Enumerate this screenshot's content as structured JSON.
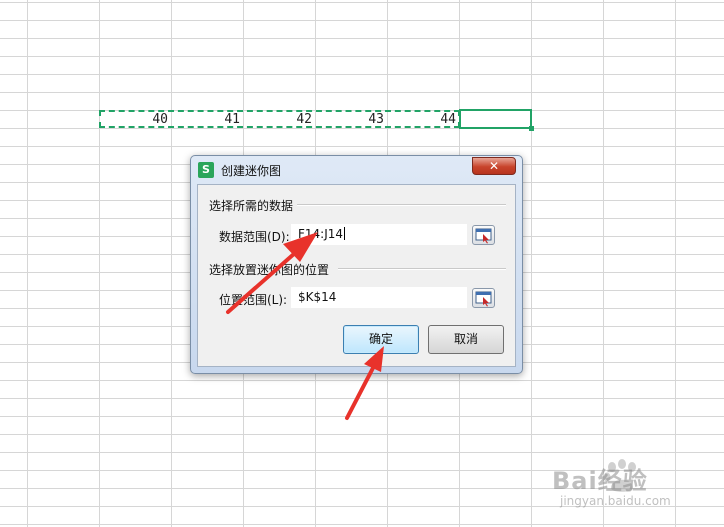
{
  "sheet": {
    "row_values": [
      "40",
      "41",
      "42",
      "43",
      "44"
    ]
  },
  "dialog": {
    "app_icon_letter": "S",
    "title": "创建迷你图",
    "close_glyph": "✕",
    "section_data": "选择所需的数据",
    "data_range_label": "数据范围(D):",
    "data_range_value": "F14:J14",
    "section_location": "选择放置迷你图的位置",
    "location_range_label": "位置范围(L):",
    "location_range_value": "$K$14",
    "ok_label": "确定",
    "cancel_label": "取消"
  },
  "watermark": {
    "brand": "Bai经验",
    "url": "jingyan.baidu.com"
  },
  "colors": {
    "selection_green": "#21a366",
    "annotation_red": "#e8322b",
    "ok_button_blue": "#bee6fd"
  },
  "icons": [
    "app-s-icon",
    "close-icon",
    "range-select-icon",
    "baidu-paw-icon"
  ]
}
